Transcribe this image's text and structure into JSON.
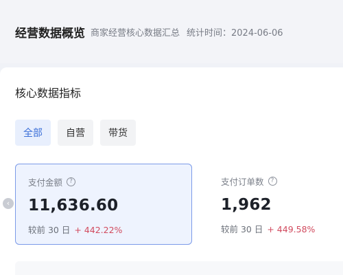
{
  "header": {
    "title": "经营数据概览",
    "subtitle": "商家经营核心数据汇总",
    "time": "统计时间：2024-06-06"
  },
  "section": {
    "title": "核心数据指标"
  },
  "tabs": [
    {
      "label": "全部",
      "active": true
    },
    {
      "label": "自营",
      "active": false
    },
    {
      "label": "带货",
      "active": false
    }
  ],
  "cards": [
    {
      "label": "支付金额",
      "value": "11,636.60",
      "compare_label": "较前 30 日",
      "delta": "+ 442.22%"
    },
    {
      "label": "支付订单数",
      "value": "1,962",
      "compare_label": "较前 30 日",
      "delta": "+ 449.58%"
    }
  ],
  "icons": {
    "help": "help-circle-icon",
    "carousel_prev": "chevron-left-icon"
  },
  "colors": {
    "accent": "#3b6fd8",
    "active_card_border": "#7b9ae8",
    "delta_positive": "#d14a5e"
  }
}
